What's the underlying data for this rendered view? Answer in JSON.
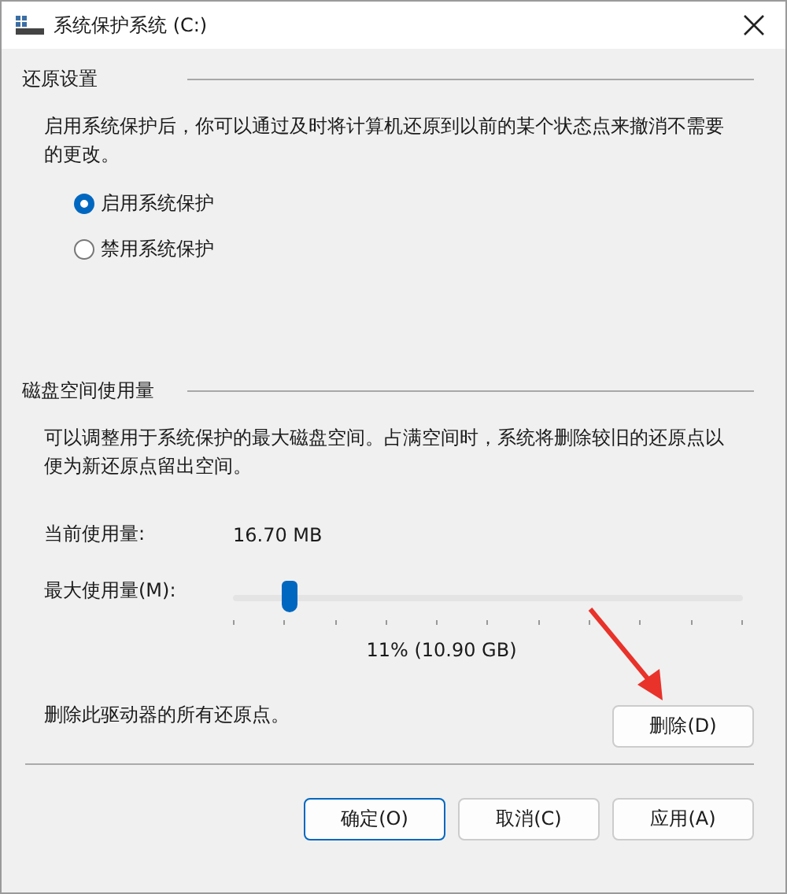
{
  "window": {
    "title": "系统保护系统 (C:)"
  },
  "restore_settings": {
    "heading": "还原设置",
    "description": "启用系统保护后，你可以通过及时将计算机还原到以前的某个状态点来撤消不需要的更改。",
    "options": [
      {
        "label": "启用系统保护",
        "selected": true
      },
      {
        "label": "禁用系统保护",
        "selected": false
      }
    ]
  },
  "disk_usage": {
    "heading": "磁盘空间使用量",
    "description": "可以调整用于系统保护的最大磁盘空间。占满空间时，系统将删除较旧的还原点以便为新还原点留出空间。",
    "current_label": "当前使用量:",
    "current_value": "16.70 MB",
    "max_label": "最大使用量(M):",
    "max_slider": {
      "level": 0.11
    },
    "max_reading": "11% (10.90 GB)",
    "delete_text": "删除此驱动器的所有还原点。",
    "delete_button": "删除(D)"
  },
  "buttons": [
    "确定(O)",
    "取消(C)",
    "应用(A)"
  ]
}
